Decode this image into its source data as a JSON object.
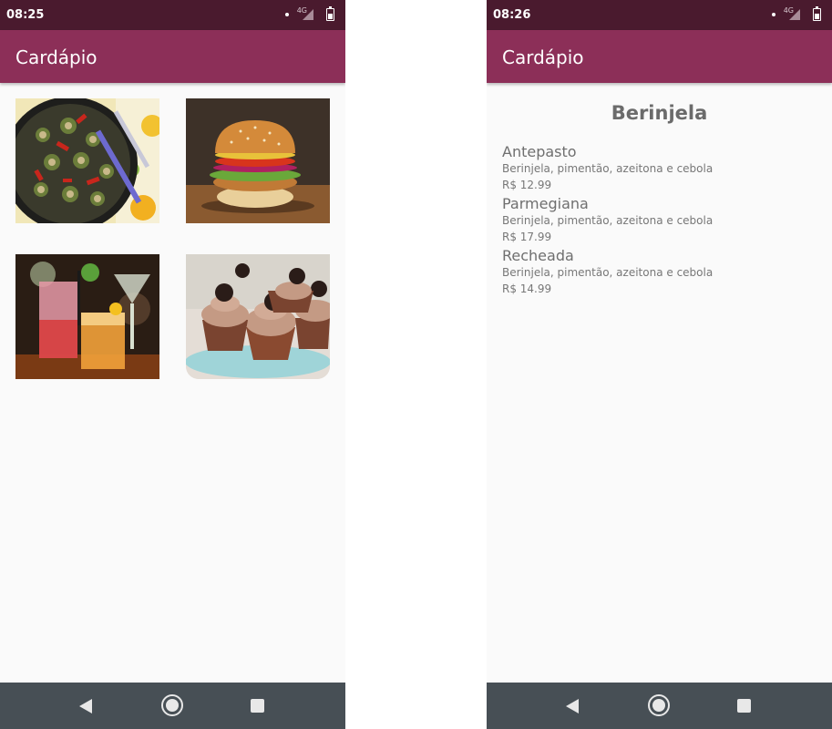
{
  "left_screen": {
    "status_bar": {
      "time": "08:25",
      "network_label": "4G"
    },
    "app_bar": {
      "title": "Cardápio"
    },
    "categories": [
      {
        "image": "eggplant-dish"
      },
      {
        "image": "burger"
      },
      {
        "image": "drinks"
      },
      {
        "image": "cupcakes"
      }
    ]
  },
  "right_screen": {
    "status_bar": {
      "time": "08:26",
      "network_label": "4G"
    },
    "app_bar": {
      "title": "Cardápio"
    },
    "detail_title": "Berinjela",
    "items": [
      {
        "name": "Antepasto",
        "description": "Berinjela, pimentão, azeitona e cebola",
        "price": "R$ 12.99"
      },
      {
        "name": "Parmegiana",
        "description": "Berinjela, pimentão, azeitona e cebola",
        "price": "R$ 17.99"
      },
      {
        "name": "Recheada",
        "description": "Berinjela, pimentão, azeitona e cebola",
        "price": "R$ 14.99"
      }
    ]
  },
  "nav_bar": {
    "icons": [
      "back-icon",
      "home-icon",
      "recents-icon"
    ]
  },
  "colors": {
    "status_bar": "#4a1a2e",
    "app_bar": "#8c2f58",
    "nav_bar": "#474f55",
    "background": "#fafafa"
  }
}
